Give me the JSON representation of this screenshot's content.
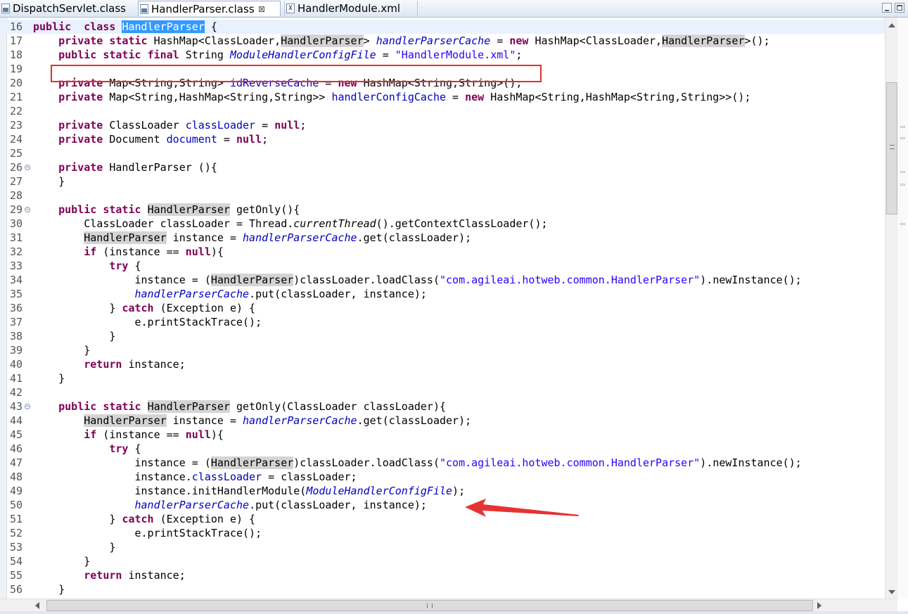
{
  "tabs": [
    {
      "label": "DispatchServlet.class",
      "icon": "class-file-icon",
      "active": false
    },
    {
      "label": "HandlerParser.class",
      "icon": "class-file-icon",
      "active": true,
      "close": "⊠"
    },
    {
      "label": "HandlerModule.xml",
      "icon": "xml-file-icon",
      "active": false
    }
  ],
  "window_controls": {
    "minimize": "minimize-icon",
    "maximize": "maximize-icon"
  },
  "editor": {
    "current_line": 16,
    "lines": [
      {
        "n": 16,
        "tokens": [
          [
            "kw",
            "public"
          ],
          [
            "",
            "  "
          ],
          [
            "kw",
            "class"
          ],
          [
            "",
            " "
          ],
          [
            "sel",
            "HandlerParser"
          ],
          [
            "",
            " {"
          ]
        ]
      },
      {
        "n": 17,
        "tokens": [
          [
            "",
            "    "
          ],
          [
            "kw",
            "private"
          ],
          [
            "",
            " "
          ],
          [
            "kw",
            "static"
          ],
          [
            "",
            " HashMap<ClassLoader,"
          ],
          [
            "occ",
            "HandlerParser"
          ],
          [
            "",
            "> "
          ],
          [
            "sfld",
            "handlerParserCache"
          ],
          [
            "",
            " = "
          ],
          [
            "kw",
            "new"
          ],
          [
            "",
            " HashMap<ClassLoader,"
          ],
          [
            "occ",
            "HandlerParser"
          ],
          [
            "",
            ">();"
          ]
        ]
      },
      {
        "n": 18,
        "tokens": [
          [
            "",
            "    "
          ],
          [
            "kw",
            "public"
          ],
          [
            "",
            " "
          ],
          [
            "kw",
            "static"
          ],
          [
            "",
            " "
          ],
          [
            "kw",
            "final"
          ],
          [
            "",
            " String "
          ],
          [
            "sfld",
            "ModuleHandlerConfigFile"
          ],
          [
            "",
            " = "
          ],
          [
            "str",
            "\"HandlerModule.xml\""
          ],
          [
            "",
            ";"
          ]
        ]
      },
      {
        "n": 19,
        "tokens": []
      },
      {
        "n": 20,
        "tokens": [
          [
            "",
            "    "
          ],
          [
            "kw",
            "private"
          ],
          [
            "",
            " Map<String,String> "
          ],
          [
            "fld",
            "idReverseCache"
          ],
          [
            "",
            " = "
          ],
          [
            "kw",
            "new"
          ],
          [
            "",
            " HashMap<String,String>();"
          ]
        ]
      },
      {
        "n": 21,
        "tokens": [
          [
            "",
            "    "
          ],
          [
            "kw",
            "private"
          ],
          [
            "",
            " Map<String,HashMap<String,String>> "
          ],
          [
            "fld",
            "handlerConfigCache"
          ],
          [
            "",
            " = "
          ],
          [
            "kw",
            "new"
          ],
          [
            "",
            " HashMap<String,HashMap<String,String>>();"
          ]
        ]
      },
      {
        "n": 22,
        "tokens": []
      },
      {
        "n": 23,
        "tokens": [
          [
            "",
            "    "
          ],
          [
            "kw",
            "private"
          ],
          [
            "",
            " ClassLoader "
          ],
          [
            "fld",
            "classLoader"
          ],
          [
            "",
            " = "
          ],
          [
            "kw",
            "null"
          ],
          [
            "",
            ";"
          ]
        ]
      },
      {
        "n": 24,
        "tokens": [
          [
            "",
            "    "
          ],
          [
            "kw",
            "private"
          ],
          [
            "",
            " Document "
          ],
          [
            "fld",
            "document"
          ],
          [
            "",
            " = "
          ],
          [
            "kw",
            "null"
          ],
          [
            "",
            ";"
          ]
        ]
      },
      {
        "n": 25,
        "tokens": []
      },
      {
        "n": 26,
        "fold": true,
        "tokens": [
          [
            "",
            "    "
          ],
          [
            "kw",
            "private"
          ],
          [
            "",
            " HandlerParser (){"
          ]
        ]
      },
      {
        "n": 27,
        "tokens": [
          [
            "",
            "    }"
          ]
        ]
      },
      {
        "n": 28,
        "tokens": []
      },
      {
        "n": 29,
        "fold": true,
        "tokens": [
          [
            "",
            "    "
          ],
          [
            "kw",
            "public"
          ],
          [
            "",
            " "
          ],
          [
            "kw",
            "static"
          ],
          [
            "",
            " "
          ],
          [
            "occ",
            "HandlerParser"
          ],
          [
            "",
            " getOnly(){"
          ]
        ]
      },
      {
        "n": 30,
        "tokens": [
          [
            "",
            "        ClassLoader classLoader = Thread."
          ],
          [
            "sm",
            "currentThread"
          ],
          [
            "",
            "().getContextClassLoader();"
          ]
        ]
      },
      {
        "n": 31,
        "tokens": [
          [
            "",
            "        "
          ],
          [
            "occ",
            "HandlerParser"
          ],
          [
            "",
            " instance = "
          ],
          [
            "sfld",
            "handlerParserCache"
          ],
          [
            "",
            ".get(classLoader);"
          ]
        ]
      },
      {
        "n": 32,
        "tokens": [
          [
            "",
            "        "
          ],
          [
            "kw",
            "if"
          ],
          [
            "",
            " (instance == "
          ],
          [
            "kw",
            "null"
          ],
          [
            "",
            "){"
          ]
        ]
      },
      {
        "n": 33,
        "tokens": [
          [
            "",
            "            "
          ],
          [
            "kw",
            "try"
          ],
          [
            "",
            " {"
          ]
        ]
      },
      {
        "n": 34,
        "tokens": [
          [
            "",
            "                instance = ("
          ],
          [
            "occ",
            "HandlerParser"
          ],
          [
            "",
            ")classLoader.loadClass("
          ],
          [
            "str",
            "\"com.agileai.hotweb.common.HandlerParser\""
          ],
          [
            "",
            ").newInstance();"
          ]
        ]
      },
      {
        "n": 35,
        "tokens": [
          [
            "",
            "                "
          ],
          [
            "sfld",
            "handlerParserCache"
          ],
          [
            "",
            ".put(classLoader, instance);"
          ]
        ]
      },
      {
        "n": 36,
        "tokens": [
          [
            "",
            "            } "
          ],
          [
            "kw",
            "catch"
          ],
          [
            "",
            " (Exception e) {"
          ]
        ]
      },
      {
        "n": 37,
        "tokens": [
          [
            "",
            "                e.printStackTrace();"
          ]
        ]
      },
      {
        "n": 38,
        "tokens": [
          [
            "",
            "            }"
          ]
        ]
      },
      {
        "n": 39,
        "tokens": [
          [
            "",
            "        }"
          ]
        ]
      },
      {
        "n": 40,
        "tokens": [
          [
            "",
            "        "
          ],
          [
            "kw",
            "return"
          ],
          [
            "",
            " instance;"
          ]
        ]
      },
      {
        "n": 41,
        "tokens": [
          [
            "",
            "    }"
          ]
        ]
      },
      {
        "n": 42,
        "tokens": []
      },
      {
        "n": 43,
        "fold": true,
        "tokens": [
          [
            "",
            "    "
          ],
          [
            "kw",
            "public"
          ],
          [
            "",
            " "
          ],
          [
            "kw",
            "static"
          ],
          [
            "",
            " "
          ],
          [
            "occ",
            "HandlerParser"
          ],
          [
            "",
            " getOnly(ClassLoader classLoader){"
          ]
        ]
      },
      {
        "n": 44,
        "tokens": [
          [
            "",
            "        "
          ],
          [
            "occ",
            "HandlerParser"
          ],
          [
            "",
            " instance = "
          ],
          [
            "sfld",
            "handlerParserCache"
          ],
          [
            "",
            ".get(classLoader);"
          ]
        ]
      },
      {
        "n": 45,
        "tokens": [
          [
            "",
            "        "
          ],
          [
            "kw",
            "if"
          ],
          [
            "",
            " (instance == "
          ],
          [
            "kw",
            "null"
          ],
          [
            "",
            "){"
          ]
        ]
      },
      {
        "n": 46,
        "tokens": [
          [
            "",
            "            "
          ],
          [
            "kw",
            "try"
          ],
          [
            "",
            " {"
          ]
        ]
      },
      {
        "n": 47,
        "tokens": [
          [
            "",
            "                instance = ("
          ],
          [
            "occ",
            "HandlerParser"
          ],
          [
            "",
            ")classLoader.loadClass("
          ],
          [
            "str",
            "\"com.agileai.hotweb.common.HandlerParser\""
          ],
          [
            "",
            ").newInstance();"
          ]
        ]
      },
      {
        "n": 48,
        "tokens": [
          [
            "",
            "                instance."
          ],
          [
            "fld",
            "classLoader"
          ],
          [
            "",
            " = classLoader;"
          ]
        ]
      },
      {
        "n": 49,
        "tokens": [
          [
            "",
            "                instance.initHandlerModule("
          ],
          [
            "sfld",
            "ModuleHandlerConfigFile"
          ],
          [
            "",
            ");"
          ]
        ]
      },
      {
        "n": 50,
        "tokens": [
          [
            "",
            "                "
          ],
          [
            "sfld",
            "handlerParserCache"
          ],
          [
            "",
            ".put(classLoader, instance);"
          ]
        ]
      },
      {
        "n": 51,
        "tokens": [
          [
            "",
            "            } "
          ],
          [
            "kw",
            "catch"
          ],
          [
            "",
            " (Exception e) {"
          ]
        ]
      },
      {
        "n": 52,
        "tokens": [
          [
            "",
            "                e.printStackTrace();"
          ]
        ]
      },
      {
        "n": 53,
        "tokens": [
          [
            "",
            "            }"
          ]
        ]
      },
      {
        "n": 54,
        "tokens": [
          [
            "",
            "        }"
          ]
        ]
      },
      {
        "n": 55,
        "tokens": [
          [
            "",
            "        "
          ],
          [
            "kw",
            "return"
          ],
          [
            "",
            " instance;"
          ]
        ]
      },
      {
        "n": 56,
        "tokens": [
          [
            "",
            "    }"
          ]
        ]
      }
    ]
  },
  "annotations": {
    "box_line": 18,
    "arrow_line": 49,
    "color": "#e03030"
  },
  "colors": {
    "keyword": "#7f0055",
    "field": "#0000c0",
    "string": "#2a00ff",
    "selection": "#3399ff",
    "occurrence": "#d4d4d4"
  }
}
